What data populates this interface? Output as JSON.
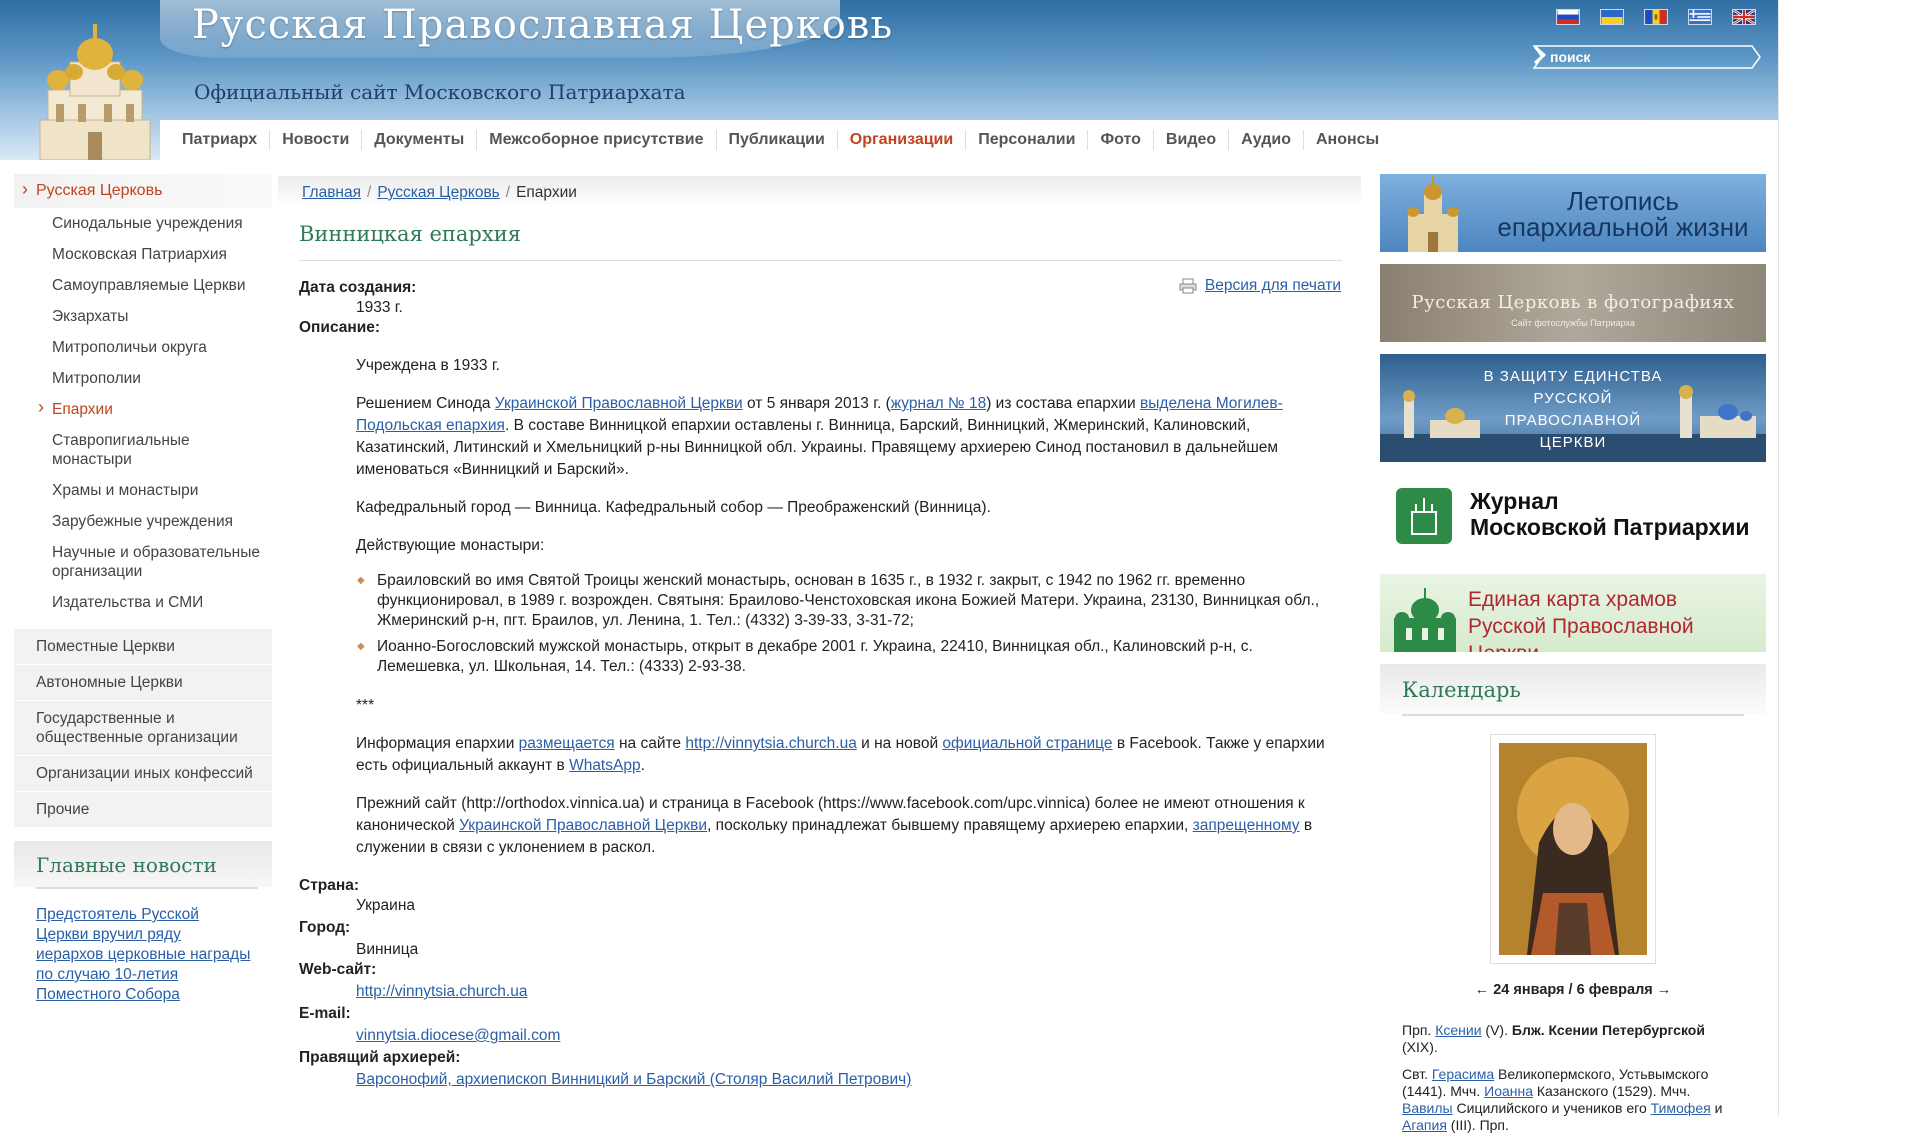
{
  "header": {
    "title": "Русская Православная Церковь",
    "subtitle": "Официальный сайт Московского Патриархата",
    "search_placeholder": "поиск",
    "flags": [
      "flag-russia",
      "flag-ukraine",
      "flag-moldova",
      "flag-greece",
      "flag-uk"
    ]
  },
  "nav": {
    "items": [
      "Патриарх",
      "Новости",
      "Документы",
      "Межсоборное присутствие",
      "Публикации",
      "Организации",
      "Персоналии",
      "Фото",
      "Видео",
      "Аудио",
      "Анонсы"
    ],
    "active": "Организации"
  },
  "sidebar": {
    "top": "Русская Церковь",
    "sub_items": [
      "Синодальные учреждения",
      "Московская Патриархия",
      "Самоуправляемые Церкви",
      "Экзархаты",
      "Митрополичьи округа",
      "Митрополии",
      "Епархии",
      "Ставропигиальные монастыри",
      "Храмы и монастыри",
      "Зарубежные учреждения",
      "Научные и образовательные организации",
      "Издательства и СМИ"
    ],
    "active_sub": "Епархии",
    "main_items": [
      "Поместные Церкви",
      "Автономные Церкви",
      "Государственные и общественные организации",
      "Организации иных конфессий",
      "Прочие"
    ],
    "news_title": "Главные новости",
    "news_link": "Предстоятель Русской Церкви вручил ряду иерархов церковные награды по случаю 10-летия Поместного Собора"
  },
  "breadcrumb": {
    "items": [
      "Главная",
      "Русская Церковь"
    ],
    "current": "Епархии"
  },
  "page": {
    "title": "Винницкая епархия",
    "print_label": "Версия для печати",
    "created_label": "Дата создания:",
    "created_value": "1933 г.",
    "desc_label": "Описание:",
    "p1": "Учреждена в 1933 г.",
    "p2": {
      "a": "Решением Синода ",
      "link1": "Украинской Православной Церкви",
      "b": " от 5 января 2013 г. (",
      "link2": "журнал № 18",
      "c": ") из состава епархии ",
      "link3": "выделена Могилев-Подольская епархия",
      "d": ". В составе Винницкой епархии оставлены г. Винница, Барский, Винницкий, Жмеринский, Калиновский, Казатинский, Литинский и Хмельницкий р-ны Винницкой обл. Украины. Правящему архиерею Синод постановил в дальнейшем именоваться «Винницкий и Барский»."
    },
    "p3": "Кафедральный город — Винница. Кафедральный собор — Преображенский (Винница).",
    "p4": "Действующие монастыри:",
    "monasteries": [
      "Браиловский во имя Святой Троицы женский монастырь, основан в 1635 г., в 1932 г. закрыт, с 1942 по 1962 гг. временно функционировал, в 1989 г. возрожден. Святыня: Браилово-Ченстоховская икона Божией Матери. Украина, 23130, Винницкая обл., Жмеринский р-н, пгт. Браилов, ул. Ленина, 1. Тел.: (4332) 3-39-33, 3-31-72;",
      "Иоанно-Богословский мужской монастырь, открыт в декабре 2001 г. Украина, 22410, Винницкая обл., Калиновский р-н, с. Лемешевка, ул. Школьная, 14. Тел.: (4333) 2-93-38."
    ],
    "stars": "***",
    "p5": {
      "a": "Информация епархии ",
      "link1": "размещается",
      "b": " на сайте ",
      "link2": "http://vinnytsia.church.ua",
      "c": " и на новой ",
      "link3": "официальной странице",
      "d": " в Facebook. Также у епархии есть официальный аккаунт в ",
      "link4": "WhatsApp",
      "e": "."
    },
    "p6": {
      "a": "Прежний сайт (http://orthodox.vinnica.ua) и страница в Facebook (https://www.facebook.com/upc.vinnica) более не имеют отношения к канонической ",
      "link1": "Украинской Православной Церкви",
      "b": ", поскольку принадлежат бывшему правящему архиерею епархии, ",
      "link2": "запрещенному",
      "c": " в служении в связи с уклонением в раскол."
    },
    "country_label": "Страна:",
    "country": "Украина",
    "city_label": "Город:",
    "city": "Винница",
    "web_label": "Web-сайт:",
    "web": "http://vinnytsia.church.ua",
    "email_label": "E-mail:",
    "email": "vinnytsia.diocese@gmail.com",
    "bishop_label": "Правящий архиерей:",
    "bishop": "Варсонофий, архиепископ Винницкий и Барский (Столяр Василий Петрович)"
  },
  "right": {
    "banner1": "Летопись епархиальной жизни",
    "banner2_title": "Русская Церковь в фотографиях",
    "banner2_sub": "Сайт фотослужбы Патриарха",
    "banner3": "В ЗАЩИТУ ЕДИНСТВА РУССКОЙ ПРАВОСЛАВНОЙ ЦЕРКВИ",
    "banner4_l1": "Журнал",
    "banner4_l2": "Московской Патриархии",
    "banner5_l1": "Единая карта храмов",
    "banner5_l2": "Русской Православной Церкви",
    "calendar_title": "Календарь",
    "calendar_date": "← 24 января / 6 февраля →",
    "saints1": {
      "a": "Прп. ",
      "link1": "Ксении",
      "b": " (V). ",
      "bold": "Блж. Ксении Петербургской",
      "c": " (XIX)."
    },
    "saints2": {
      "a": "Свт. ",
      "link1": "Герасима",
      "b": " Великопермского, Устьвымского (1441). Мчч. ",
      "link2": "Иоанна",
      "c": " Казанского (1529). Мчч. ",
      "link3": "Вавилы",
      "d": " Сицилийского и учеников его ",
      "link4": "Тимофея",
      "e": " и ",
      "link5": "Агапия",
      "f": " (III). Прп."
    }
  },
  "colors": {
    "accent": "#c0441f",
    "heading": "#2f7a56",
    "link": "#2a5fa8"
  }
}
